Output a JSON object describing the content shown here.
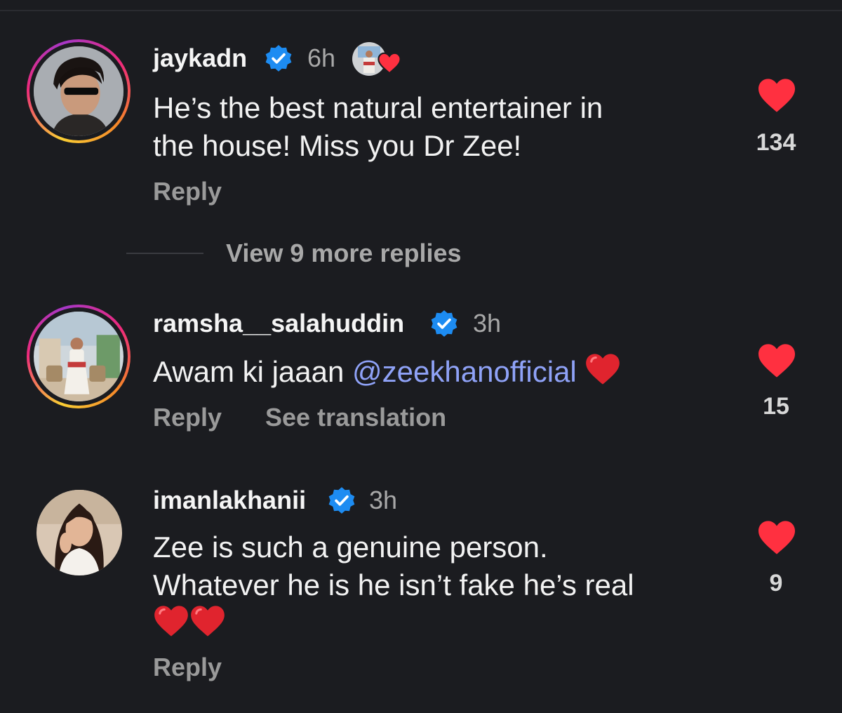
{
  "comments": [
    {
      "username": "jaykadn",
      "time": "6h",
      "text_line1": "He’s the best natural entertainer in",
      "text_line2": "the house! Miss you Dr Zee!",
      "reply_label": "Reply",
      "likes": "134",
      "liked_by_creator": true
    },
    {
      "username": "ramsha__salahuddin",
      "time": "3h",
      "text_before": "Awam ki jaaan ",
      "mention": "@zeekhanofficial",
      "reply_label": "Reply",
      "translate_label": "See translation",
      "likes": "15"
    },
    {
      "username": "imanlakhanii",
      "time": "3h",
      "text_line1": "Zee is such a genuine person.",
      "text_line2": "Whatever he is he isn’t fake he’s real",
      "reply_label": "Reply",
      "likes": "9"
    }
  ],
  "view_more_replies": "View 9 more replies",
  "colors": {
    "background": "#1b1c20",
    "like": "#ff3040",
    "verified": "#1d8cf2",
    "mention": "#8fa2f7"
  },
  "icons": [
    "verified-badge-icon",
    "heart-icon",
    "red-heart-emoji",
    "creator-liked-icon"
  ]
}
